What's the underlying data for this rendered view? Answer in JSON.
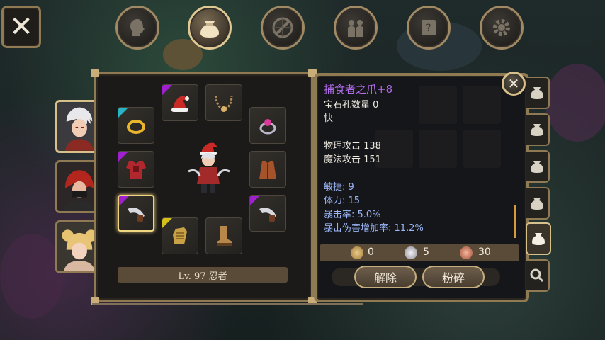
{
  "nav": {
    "tabs": [
      {
        "name": "character-tab",
        "icon": "head-icon",
        "active": false
      },
      {
        "name": "inventory-tab",
        "icon": "bag-icon",
        "active": true
      },
      {
        "name": "skills-tab",
        "icon": "compass-sword-icon",
        "active": false
      },
      {
        "name": "party-tab",
        "icon": "people-icon",
        "active": false
      },
      {
        "name": "quest-tab",
        "icon": "scroll-icon",
        "active": false
      },
      {
        "name": "settings-tab",
        "icon": "gear-icon",
        "active": false
      }
    ]
  },
  "equipment": {
    "level_label": "Lv. 97 忍者"
  },
  "item": {
    "name": "捕食者之爪+8",
    "socket_line": "宝石孔数量 0",
    "speed_line": "快",
    "phys_attack": "物理攻击 138",
    "magic_attack": "魔法攻击 151",
    "bonus_agility": "敏捷: 9",
    "bonus_stamina": "体力: 15",
    "bonus_crit_rate": "暴击率: 5.0%",
    "bonus_crit_damage": "暴击伤害增加率: 11.2%"
  },
  "currency": {
    "gold": "0",
    "silver": "5",
    "copper": "30"
  },
  "actions": {
    "unequip": "解除",
    "smash": "粉碎"
  },
  "colors": {
    "frame": "#8f7a53",
    "item_name": "#b06be7",
    "bonus_stat": "#9cb7f7",
    "purple_rarity": "#a020d0",
    "cyan_rarity": "#27b5c6",
    "yellow_rarity": "#d4c21a"
  }
}
